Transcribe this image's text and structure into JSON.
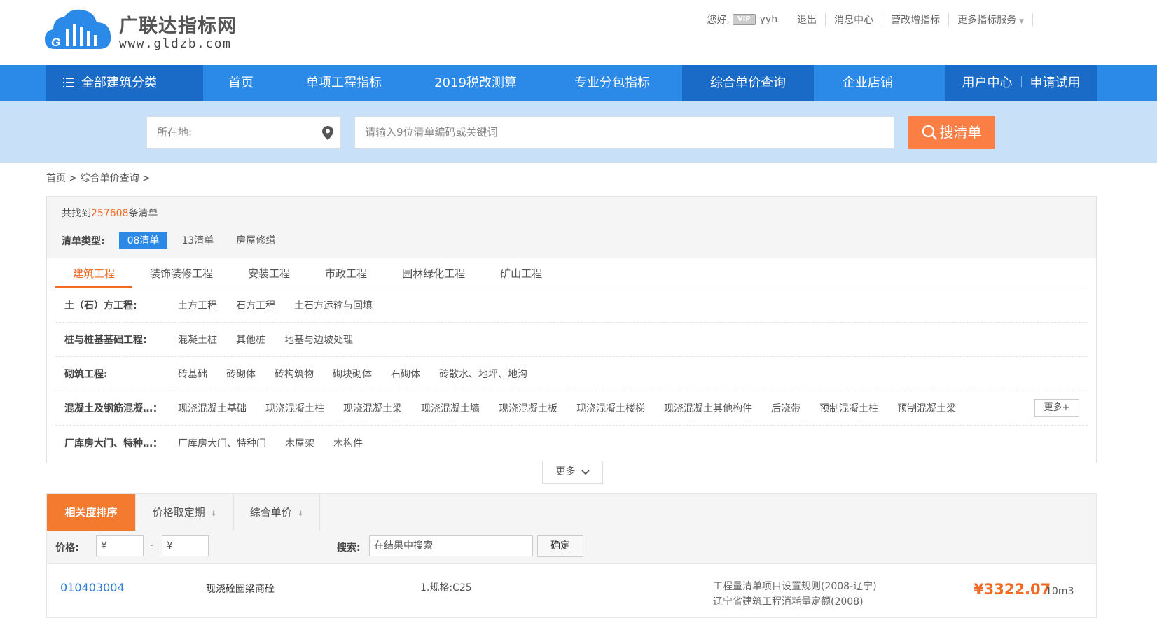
{
  "brand": {
    "name": "广联达指标网",
    "url": "www.gldzb.com"
  },
  "topbar": {
    "greeting": "您好,",
    "vip_badge": "VIP",
    "username": "yyh",
    "logout": "退出",
    "messages": "消息中心",
    "vat_index": "营改增指标",
    "more_services": "更多指标服务"
  },
  "nav": {
    "all_categories": "全部建筑分类",
    "items": [
      "首页",
      "单项工程指标",
      "2019税改测算",
      "专业分包指标",
      "综合单价查询",
      "企业店铺"
    ],
    "active_index": 4,
    "user_center": "用户中心",
    "apply_trial": "申请试用"
  },
  "search": {
    "location_placeholder": "所在地:",
    "keyword_placeholder": "请输入9位清单编码或关键词",
    "button": "搜清单"
  },
  "breadcrumb": "首页 > 综合单价查询 >",
  "filters": {
    "found_prefix": "共找到",
    "found_count": "257608",
    "found_suffix": "条清单",
    "type_label": "清单类型:",
    "types": [
      "08清单",
      "13清单",
      "房屋修缮"
    ],
    "active_type": 0,
    "tabs": [
      "建筑工程",
      "装饰装修工程",
      "安装工程",
      "市政工程",
      "园林绿化工程",
      "矿山工程"
    ],
    "active_tab": 0,
    "categories": [
      {
        "name": "土（石）方工程:",
        "items": [
          "土方工程",
          "石方工程",
          "土石方运输与回填"
        ]
      },
      {
        "name": "桩与桩基基础工程:",
        "items": [
          "混凝土桩",
          "其他桩",
          "地基与边坡处理"
        ]
      },
      {
        "name": "砌筑工程:",
        "items": [
          "砖基础",
          "砖砌体",
          "砖构筑物",
          "砌块砌体",
          "石砌体",
          "砖散水、地坪、地沟"
        ]
      },
      {
        "name": "混凝土及钢筋混凝…：",
        "items": [
          "现浇混凝土基础",
          "现浇混凝土柱",
          "现浇混凝土梁",
          "现浇混凝土墙",
          "现浇混凝土板",
          "现浇混凝土楼梯",
          "现浇混凝土其他构件",
          "后浇带",
          "预制混凝土柱",
          "预制混凝土梁"
        ],
        "more": "更多+"
      },
      {
        "name": "厂库房大门、特种…：",
        "items": [
          "厂库房大门、特种门",
          "木屋架",
          "木构件"
        ]
      }
    ],
    "more": "更多"
  },
  "sort": {
    "options": [
      "相关度排序",
      "价格取定期",
      "综合单价"
    ],
    "active": 0
  },
  "result_filter": {
    "price_label": "价格:",
    "price_min_placeholder": "¥",
    "price_max_placeholder": "¥",
    "search_label": "搜索:",
    "search_placeholder": "在结果中搜索",
    "confirm": "确定"
  },
  "results": [
    {
      "code": "010403004",
      "name": "现浇砼圈梁商砼",
      "spec": "1.规格:C25",
      "source1": "工程量清单项目设置规则(2008-辽宁)",
      "source2": "辽宁省建筑工程消耗量定额(2008)",
      "price": "¥3322.07",
      "unit": "10m3"
    }
  ],
  "colors": {
    "nav_blue": "#2b8ae8",
    "accent_orange": "#f06a23",
    "band_blue": "#c8e1f8"
  }
}
